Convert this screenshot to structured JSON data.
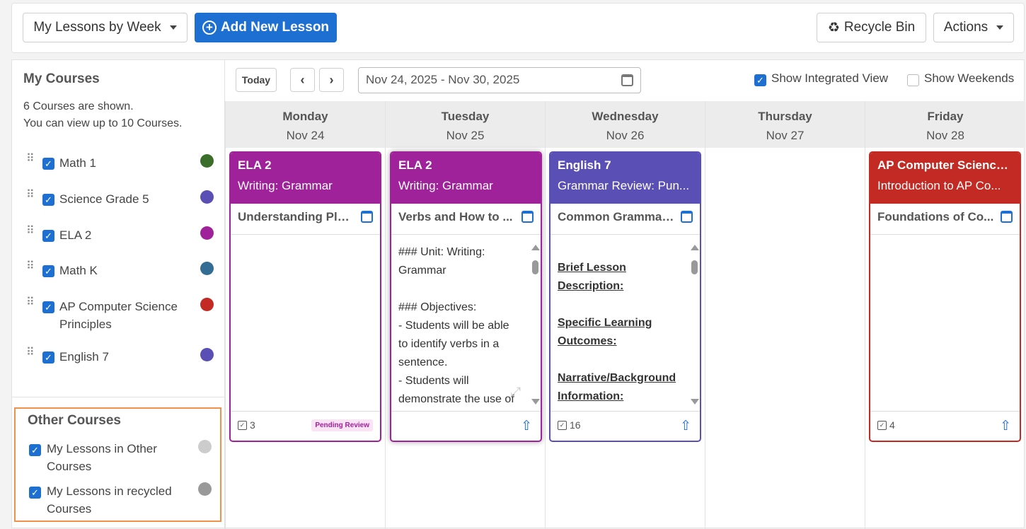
{
  "topbar": {
    "view_select": "My Lessons by Week",
    "add_lesson": "Add New Lesson",
    "recycle_bin": "Recycle Bin",
    "actions": "Actions"
  },
  "sidebar": {
    "title": "My Courses",
    "shown_line1": "6 Courses are shown.",
    "shown_line2": "You can view up to 10 Courses.",
    "courses": [
      {
        "label": "Math 1",
        "color": "#3b6e2a"
      },
      {
        "label": "Science Grade 5",
        "color": "#5a4fb5"
      },
      {
        "label": "ELA 2",
        "color": "#a0229a"
      },
      {
        "label": "Math K",
        "color": "#336d94"
      },
      {
        "label": "AP Computer Science Principles",
        "color": "#c32a23"
      },
      {
        "label": "English 7",
        "color": "#5a4fb5"
      }
    ],
    "other_title": "Other Courses",
    "other_courses": [
      {
        "label": "My Lessons in Other Courses",
        "color": "#cccccc"
      },
      {
        "label": "My Lessons in recycled Courses",
        "color": "#999999"
      }
    ]
  },
  "toolbar": {
    "today": "Today",
    "date_range": "Nov 24, 2025 - Nov 30, 2025",
    "integrated_view": "Show Integrated View",
    "weekends": "Show Weekends"
  },
  "days": [
    {
      "name": "Monday",
      "date": "Nov 24"
    },
    {
      "name": "Tuesday",
      "date": "Nov 25"
    },
    {
      "name": "Wednesday",
      "date": "Nov 26"
    },
    {
      "name": "Thursday",
      "date": "Nov 27"
    },
    {
      "name": "Friday",
      "date": "Nov 28"
    }
  ],
  "cards": {
    "mon": {
      "course": "ELA 2",
      "unit": "Writing: Grammar",
      "lesson": "Understanding Plur...",
      "count": "3",
      "badge": "Pending Review",
      "color": "#a0229a"
    },
    "tue": {
      "course": "ELA 2",
      "unit": "Writing: Grammar",
      "lesson": "Verbs and How to ...",
      "color": "#a0229a",
      "body": [
        "### Unit: Writing:",
        "Grammar",
        "",
        "### Objectives:",
        "- Students will be able",
        "to identify verbs in a",
        "sentence.",
        "- Students will",
        "demonstrate the use of"
      ]
    },
    "wed": {
      "course": "English 7",
      "unit": "Grammar Review: Pun...",
      "lesson": "Common Grammar...",
      "count": "16",
      "color": "#5a4fb5",
      "body": [
        "Brief Lesson",
        "Description:",
        "Specific Learning",
        "Outcomes:",
        "Narrative/Background",
        "Information:"
      ]
    },
    "fri": {
      "course": "AP Computer Science ...",
      "unit": "Introduction to AP Co...",
      "lesson": "Foundations of Co...",
      "count": "4",
      "color": "#c32a23"
    }
  }
}
